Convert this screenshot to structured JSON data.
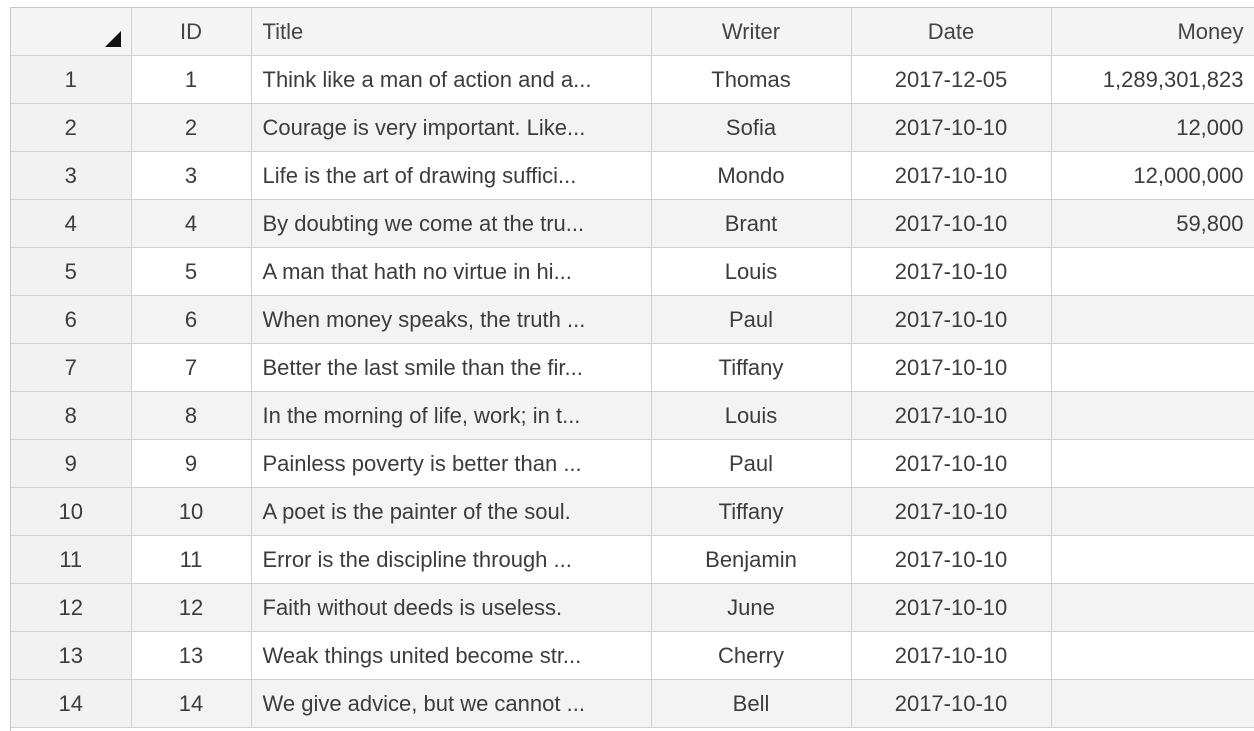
{
  "table": {
    "columns": [
      {
        "key": "id",
        "label": "ID",
        "align": "center"
      },
      {
        "key": "title",
        "label": "Title",
        "align": "left"
      },
      {
        "key": "writer",
        "label": "Writer",
        "align": "center"
      },
      {
        "key": "date",
        "label": "Date",
        "align": "center"
      },
      {
        "key": "money",
        "label": "Money",
        "align": "right"
      }
    ],
    "rows": [
      {
        "num": "1",
        "id": "1",
        "title": "Think like a man of action and a...",
        "writer": "Thomas",
        "date": "2017-12-05",
        "money": "1,289,301,823"
      },
      {
        "num": "2",
        "id": "2",
        "title": "Courage is very important. Like...",
        "writer": "Sofia",
        "date": "2017-10-10",
        "money": "12,000"
      },
      {
        "num": "3",
        "id": "3",
        "title": "Life is the art of drawing suffici...",
        "writer": "Mondo",
        "date": "2017-10-10",
        "money": "12,000,000"
      },
      {
        "num": "4",
        "id": "4",
        "title": "By doubting we come at the tru...",
        "writer": "Brant",
        "date": "2017-10-10",
        "money": "59,800"
      },
      {
        "num": "5",
        "id": "5",
        "title": "A man that hath no virtue in hi...",
        "writer": "Louis",
        "date": "2017-10-10",
        "money": ""
      },
      {
        "num": "6",
        "id": "6",
        "title": "When money speaks, the truth ...",
        "writer": "Paul",
        "date": "2017-10-10",
        "money": ""
      },
      {
        "num": "7",
        "id": "7",
        "title": "Better the last smile than the fir...",
        "writer": "Tiffany",
        "date": "2017-10-10",
        "money": ""
      },
      {
        "num": "8",
        "id": "8",
        "title": "In the morning of life, work; in t...",
        "writer": "Louis",
        "date": "2017-10-10",
        "money": ""
      },
      {
        "num": "9",
        "id": "9",
        "title": "Painless poverty is better than ...",
        "writer": "Paul",
        "date": "2017-10-10",
        "money": ""
      },
      {
        "num": "10",
        "id": "10",
        "title": "A poet is the painter of the soul.",
        "writer": "Tiffany",
        "date": "2017-10-10",
        "money": ""
      },
      {
        "num": "11",
        "id": "11",
        "title": "Error is the discipline through ...",
        "writer": "Benjamin",
        "date": "2017-10-10",
        "money": ""
      },
      {
        "num": "12",
        "id": "12",
        "title": "Faith without deeds is useless.",
        "writer": "June",
        "date": "2017-10-10",
        "money": ""
      },
      {
        "num": "13",
        "id": "13",
        "title": "Weak things united become str...",
        "writer": "Cherry",
        "date": "2017-10-10",
        "money": ""
      },
      {
        "num": "14",
        "id": "14",
        "title": "We give advice, but we cannot ...",
        "writer": "Bell",
        "date": "2017-10-10",
        "money": ""
      }
    ]
  }
}
